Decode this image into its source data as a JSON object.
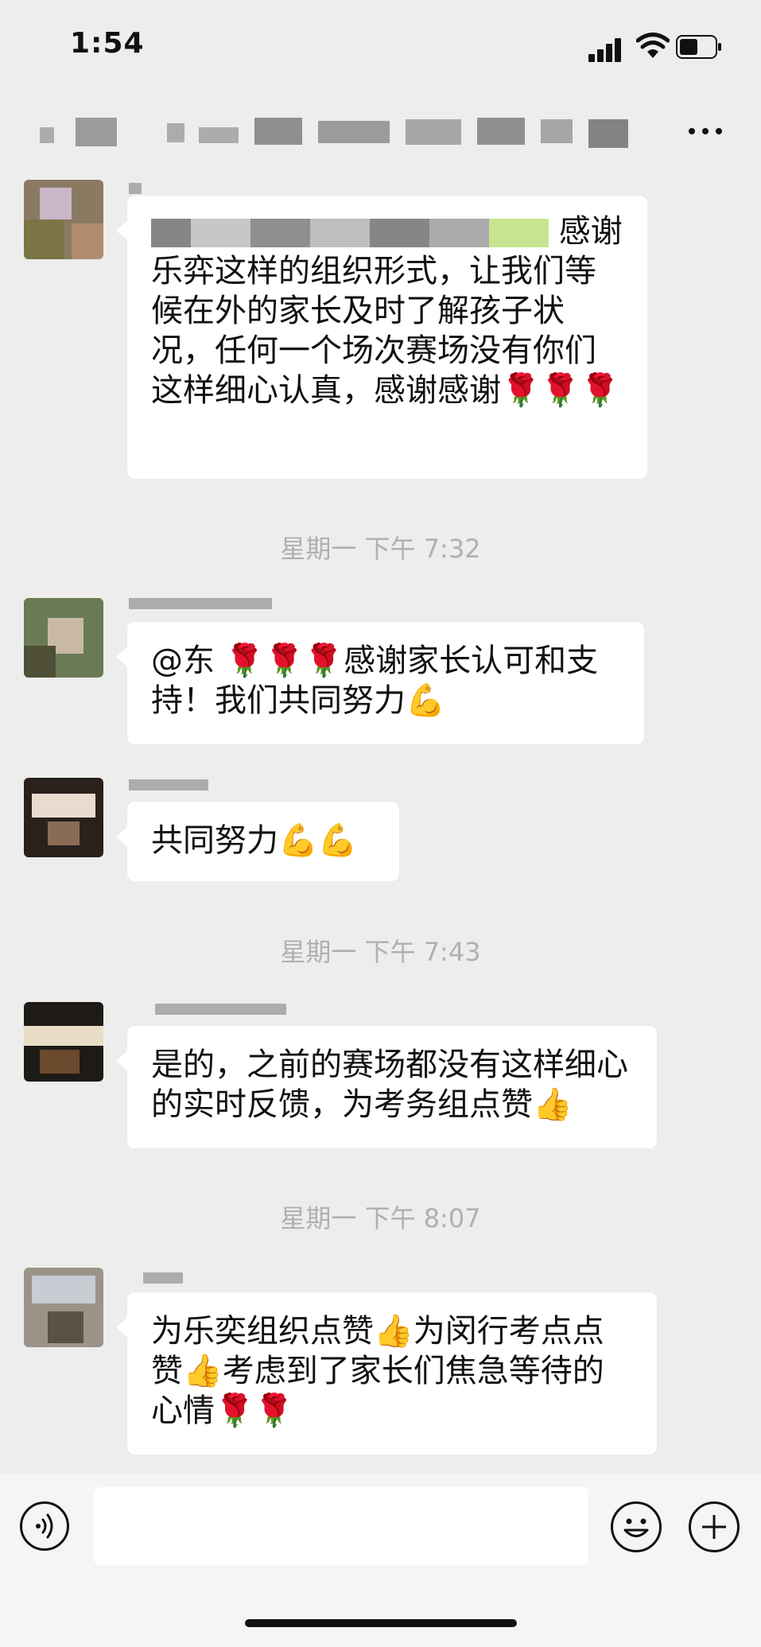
{
  "status_bar": {
    "time": "1:54"
  },
  "chat": {
    "messages": [
      {
        "text": "感谢乐弈这样的组织形式，让我们等候在外的家长及时了解孩子状况，任何一个场次赛场没有你们这样细心认真，感谢感谢🌹🌹🌹"
      },
      {
        "timestamp": "星期一 下午 7:32"
      },
      {
        "text": "@东 🌹🌹🌹感谢家长认可和支持！我们共同努力💪"
      },
      {
        "text": "共同努力💪💪"
      },
      {
        "timestamp": "星期一 下午 7:43"
      },
      {
        "text": "是的，之前的赛场都没有这样细心的实时反馈，为考务组点赞👍"
      },
      {
        "timestamp": "星期一 下午 8:07"
      },
      {
        "text": "为乐奕组织点赞👍为闵行考点点赞👍考虑到了家长们焦急等待的心情🌹🌹"
      }
    ]
  },
  "colors": {
    "background": "#ededed",
    "bubble": "#ffffff",
    "timestamp": "#b0b0b0"
  },
  "icons": {
    "more": "more-icon",
    "voice": "voice-icon",
    "emoji": "emoji-icon",
    "plus": "plus-icon"
  }
}
